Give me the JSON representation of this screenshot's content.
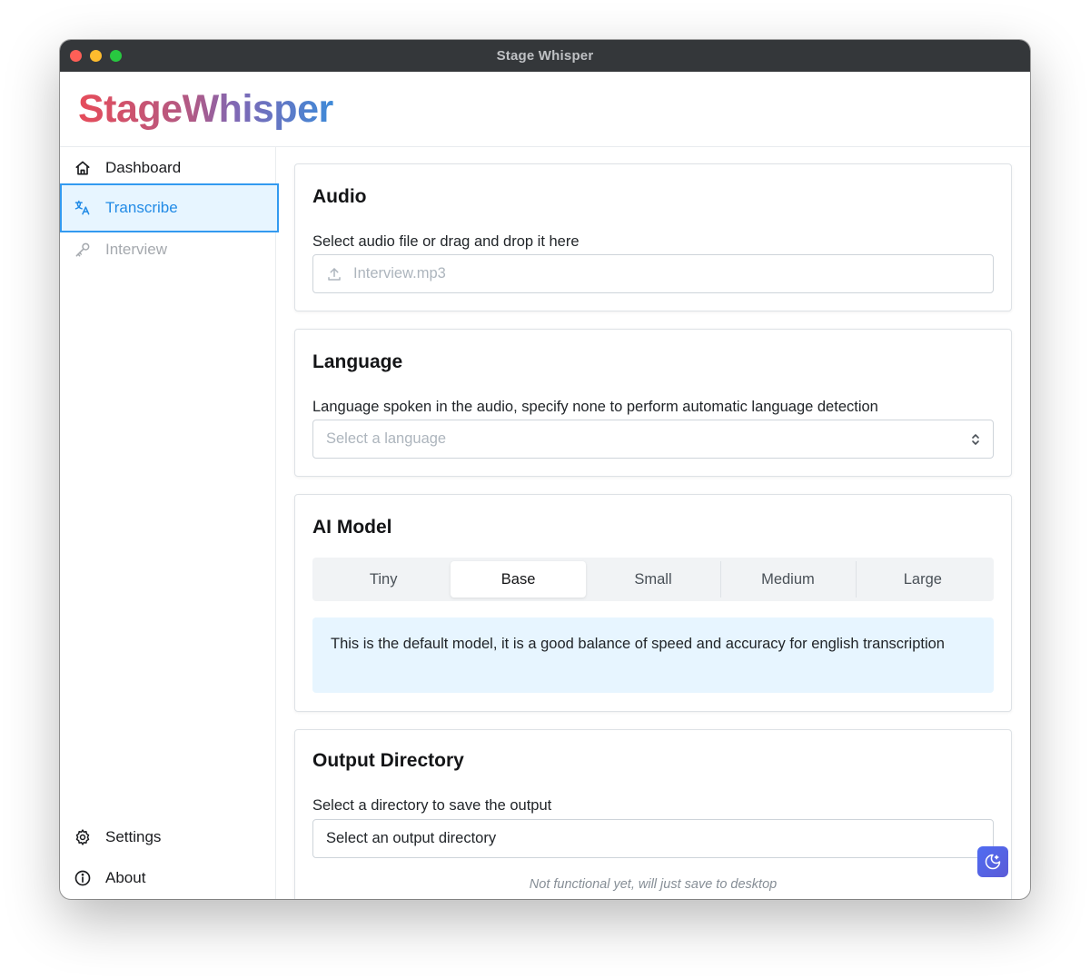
{
  "window": {
    "title": "Stage Whisper"
  },
  "header": {
    "logo": "StageWhisper"
  },
  "sidebar": {
    "items": [
      {
        "label": "Dashboard",
        "icon": "home-icon",
        "state": "normal"
      },
      {
        "label": "Transcribe",
        "icon": "translate-icon",
        "state": "active"
      },
      {
        "label": "Interview",
        "icon": "key-icon",
        "state": "disabled"
      }
    ],
    "footer_items": [
      {
        "label": "Settings",
        "icon": "gear-icon"
      },
      {
        "label": "About",
        "icon": "info-icon"
      }
    ]
  },
  "audio": {
    "title": "Audio",
    "label": "Select audio file or drag and drop it here",
    "placeholder": "Interview.mp3",
    "icon": "upload-icon"
  },
  "language": {
    "title": "Language",
    "label": "Language spoken in the audio, specify none to perform automatic language detection",
    "placeholder": "Select a language",
    "icon": "chevron-up-down-icon"
  },
  "model": {
    "title": "AI Model",
    "options": [
      "Tiny",
      "Base",
      "Small",
      "Medium",
      "Large"
    ],
    "selected": "Base",
    "description": "This is the default model, it is a good balance of speed and accuracy for english transcription"
  },
  "output": {
    "title": "Output Directory",
    "label": "Select a directory to save the output",
    "value": "Select an output directory",
    "note": "Not functional yet, will just save to desktop"
  },
  "theme_toggle": {
    "icon": "moon-stars-icon"
  },
  "colors": {
    "accent": "#228be6",
    "active_bg": "#e7f5ff",
    "titlebar": "#34373a",
    "logo_gradient": [
      "#e64c5a",
      "#3e8ad8"
    ]
  }
}
